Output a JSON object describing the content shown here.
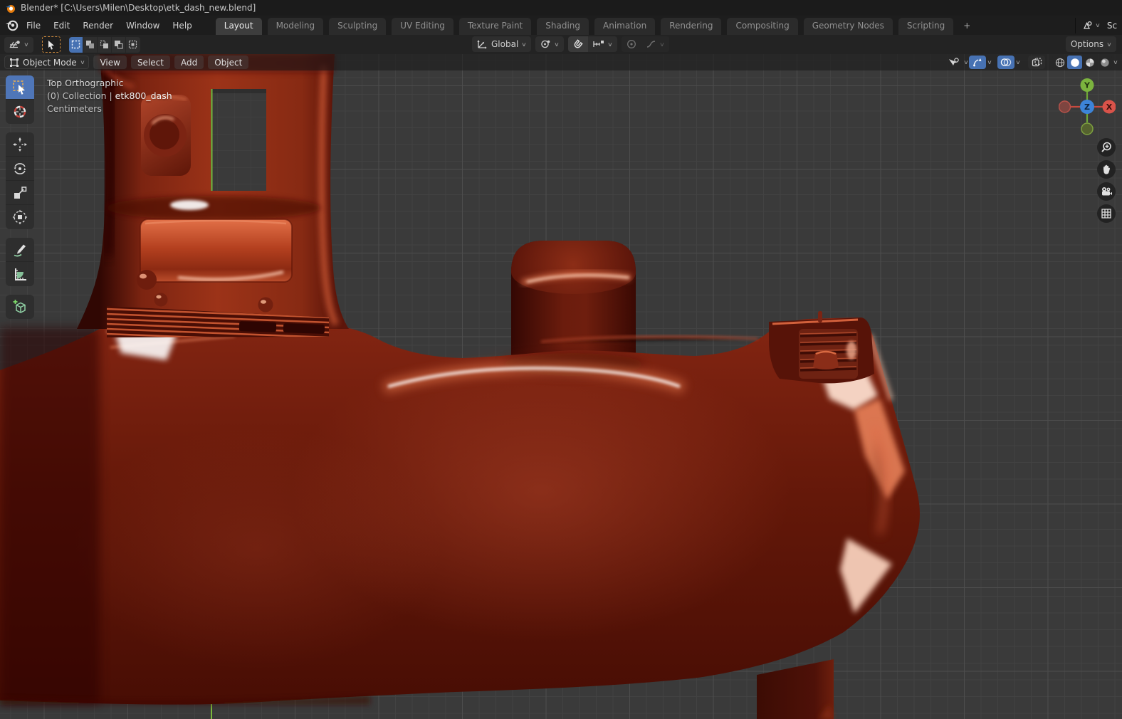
{
  "window": {
    "app_title": "Blender* [C:\\Users\\Milen\\Desktop\\etk_dash_new.blend]"
  },
  "menubar": {
    "menus": [
      {
        "label": "File"
      },
      {
        "label": "Edit"
      },
      {
        "label": "Render"
      },
      {
        "label": "Window"
      },
      {
        "label": "Help"
      }
    ],
    "tabs": [
      {
        "label": "Layout",
        "active": true
      },
      {
        "label": "Modeling",
        "active": false
      },
      {
        "label": "Sculpting",
        "active": false
      },
      {
        "label": "UV Editing",
        "active": false
      },
      {
        "label": "Texture Paint",
        "active": false
      },
      {
        "label": "Shading",
        "active": false
      },
      {
        "label": "Animation",
        "active": false
      },
      {
        "label": "Rendering",
        "active": false
      },
      {
        "label": "Compositing",
        "active": false
      },
      {
        "label": "Geometry Nodes",
        "active": false
      },
      {
        "label": "Scripting",
        "active": false
      }
    ],
    "new_workspace_label": "+",
    "scene_label": "Sc"
  },
  "toolbar": {
    "orientation_label": "Global",
    "options_label": "Options"
  },
  "viewport_header": {
    "mode_label": "Object Mode",
    "menus": [
      {
        "label": "View"
      },
      {
        "label": "Select"
      },
      {
        "label": "Add"
      },
      {
        "label": "Object"
      }
    ]
  },
  "viewport": {
    "overlay_line1": "Top Orthographic",
    "overlay_line2_prefix": "(0) Collection | ",
    "overlay_line2_object": "etk800_dash",
    "overlay_line3": "Centimeters"
  },
  "gizmo": {
    "x_label": "X",
    "y_label": "Y",
    "z_label": "Z"
  },
  "icons": {
    "chevron": "chevron-down-icon",
    "magnet": "snap-magnet-icon",
    "zoom": "zoom-icon",
    "pan": "hand-icon",
    "camera": "camera-view-icon",
    "grid": "perspective-grid-icon"
  },
  "colors": {
    "accent_blue": "#4772b3",
    "blender_orange": "#e87d0d",
    "viewport_background": "#3a3a3a",
    "grid_minor": "#424242",
    "grid_major": "#4d4d4d",
    "axis_y_green": "#7cb83c",
    "model_red": "#7a2012",
    "model_dark_red": "#4a0e05",
    "model_highlight": "#ffd9c8",
    "active_tool_blue": "#4f76b8"
  }
}
